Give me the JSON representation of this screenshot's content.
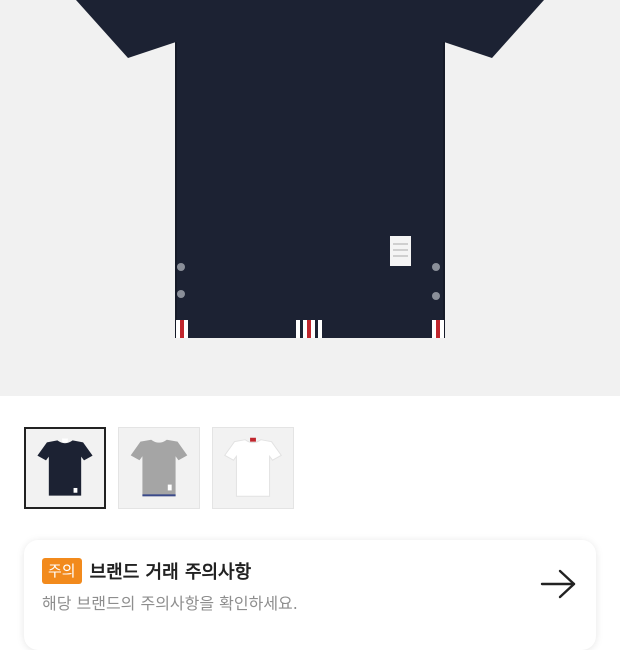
{
  "product": {
    "hero_image": "navy-tshirt-photo",
    "thumbnails": [
      {
        "name": "navy-tshirt",
        "selected": true
      },
      {
        "name": "gray-tshirt",
        "selected": false
      },
      {
        "name": "white-tshirt",
        "selected": false
      }
    ]
  },
  "notice": {
    "badge": "주의",
    "title": "브랜드 거래 주의사항",
    "subtitle": "해당 브랜드의 주의사항을 확인하세요.",
    "icon": "arrow-right-icon"
  },
  "colors": {
    "badge_bg": "#f28a1c",
    "navy": "#1c2233",
    "gray_shirt": "#a5a5a5"
  }
}
